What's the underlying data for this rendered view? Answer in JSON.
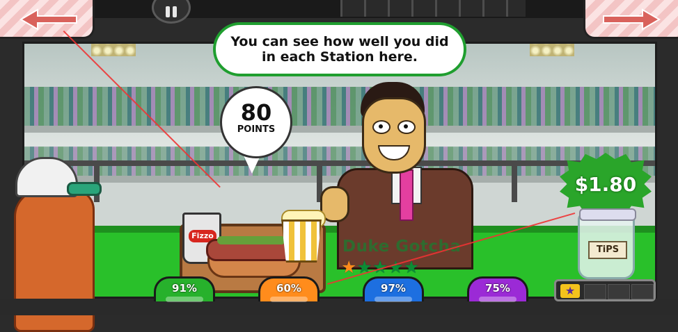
{
  "header": {
    "back_icon": "arrow-left-icon",
    "next_icon": "arrow-right-icon",
    "pause_icon": "pause-icon"
  },
  "tutorial": {
    "message_line1": "You can see how well you did",
    "message_line2": "in each Station here."
  },
  "score": {
    "points": "80",
    "points_label": "POINTS"
  },
  "customer": {
    "name": "Duke Gotcha",
    "stars_total": 5,
    "stars_filled": 1
  },
  "order": {
    "drink_label": "Fizzo",
    "items": [
      "drink-cup",
      "hot-dog",
      "popcorn"
    ]
  },
  "tips": {
    "amount": "$1.80",
    "jar_label": "TiPS"
  },
  "stations": [
    {
      "name": "station-1",
      "score": "91%",
      "color": "#27b12c"
    },
    {
      "name": "station-2",
      "score": "60%",
      "color": "#ff8c1c"
    },
    {
      "name": "station-3",
      "score": "97%",
      "color": "#1d6fe0"
    },
    {
      "name": "station-4",
      "score": "75%",
      "color": "#9b2ad6"
    }
  ],
  "colors": {
    "field": "#29c02a",
    "bubble_border": "#1f9e2f",
    "tips_badge": "#2aa52a",
    "star_filled": "#ff8a1a",
    "star_empty": "#0c8c34"
  }
}
